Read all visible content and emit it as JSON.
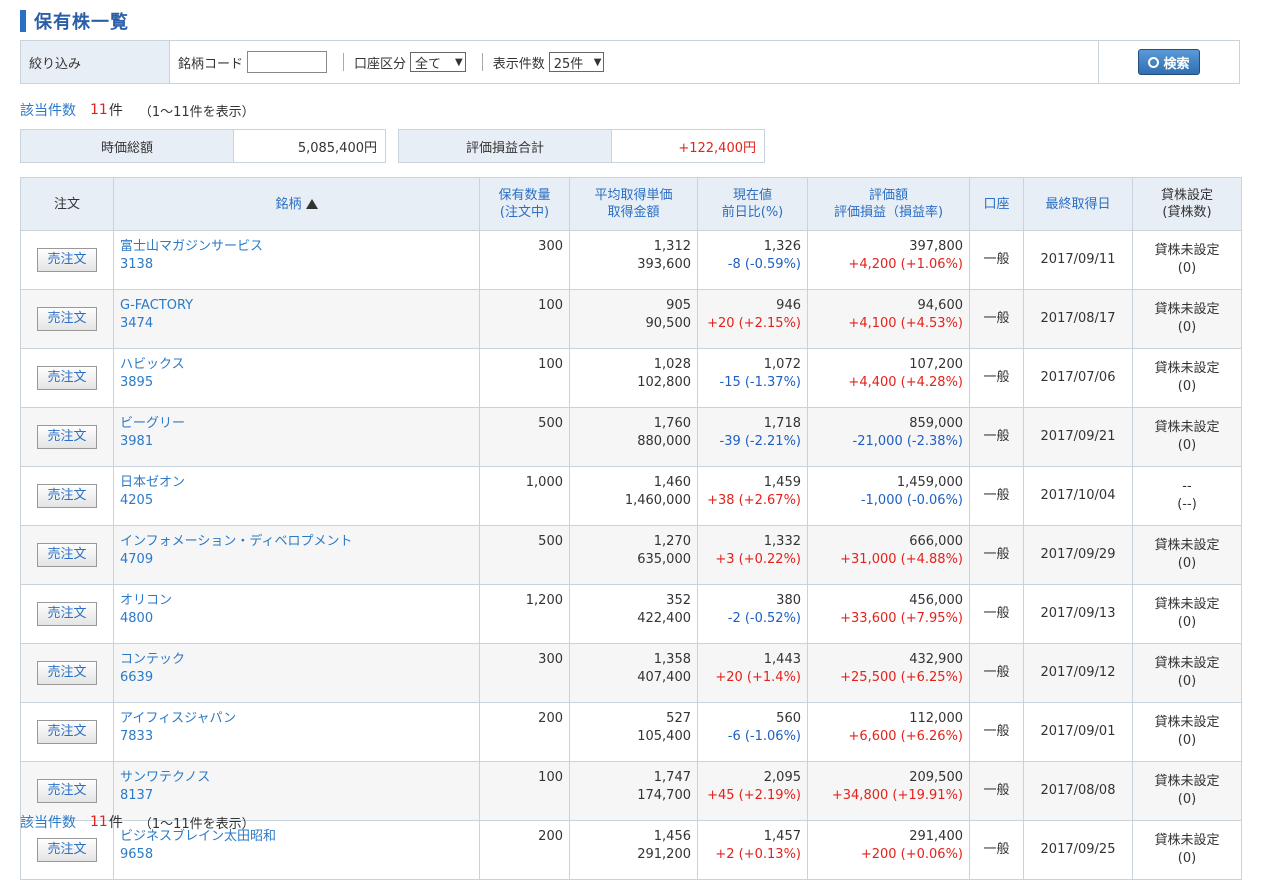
{
  "page": {
    "title": "保有株一覧"
  },
  "filter": {
    "label": "絞り込み",
    "code_label": "銘柄コード",
    "code_value": "",
    "account_label": "口座区分",
    "account_selected": "全て",
    "count_label": "表示件数",
    "count_selected": "25件",
    "search_label": "検索"
  },
  "count_top": {
    "label": "該当件数",
    "num": "11",
    "unit": "件",
    "range": "（1～11件を表示）"
  },
  "count_bottom": {
    "label": "該当件数",
    "num": "11",
    "unit": "件",
    "range": "（1～11件を表示）"
  },
  "summary": {
    "market_value_label": "時価総額",
    "market_value": "5,085,400円",
    "pl_total_label": "評価損益合計",
    "pl_total": "+122,400円"
  },
  "table": {
    "headers": {
      "order": "注文",
      "stock": "銘柄",
      "qty1": "保有数量",
      "qty2": "(注文中)",
      "avg1": "平均取得単価",
      "avg2": "取得金額",
      "price1": "現在値",
      "price2": "前日比(%)",
      "val1": "評価額",
      "val2": "評価損益（損益率)",
      "account": "口座",
      "date": "最終取得日",
      "lend1": "貸株設定",
      "lend2": "(貸株数)"
    },
    "sell_label": "売注文",
    "rows": [
      {
        "name": "富士山マガジンサービス",
        "code": "3138",
        "qty": "300",
        "avg": "1,312",
        "cost": "393,600",
        "price": "1,326",
        "change": "-8 (-0.59%)",
        "change_sign": "neg",
        "value": "397,800",
        "pl": "+4,200 (+1.06%)",
        "pl_sign": "pos",
        "account": "一般",
        "date": "2017/09/11",
        "lend": "貸株未設定",
        "lend_count": "(0)"
      },
      {
        "name": "G-FACTORY",
        "code": "3474",
        "qty": "100",
        "avg": "905",
        "cost": "90,500",
        "price": "946",
        "change": "+20 (+2.15%)",
        "change_sign": "pos",
        "value": "94,600",
        "pl": "+4,100 (+4.53%)",
        "pl_sign": "pos",
        "account": "一般",
        "date": "2017/08/17",
        "lend": "貸株未設定",
        "lend_count": "(0)"
      },
      {
        "name": "ハビックス",
        "code": "3895",
        "qty": "100",
        "avg": "1,028",
        "cost": "102,800",
        "price": "1,072",
        "change": "-15 (-1.37%)",
        "change_sign": "neg",
        "value": "107,200",
        "pl": "+4,400 (+4.28%)",
        "pl_sign": "pos",
        "account": "一般",
        "date": "2017/07/06",
        "lend": "貸株未設定",
        "lend_count": "(0)"
      },
      {
        "name": "ビーグリー",
        "code": "3981",
        "qty": "500",
        "avg": "1,760",
        "cost": "880,000",
        "price": "1,718",
        "change": "-39 (-2.21%)",
        "change_sign": "neg",
        "value": "859,000",
        "pl": "-21,000 (-2.38%)",
        "pl_sign": "neg",
        "account": "一般",
        "date": "2017/09/21",
        "lend": "貸株未設定",
        "lend_count": "(0)"
      },
      {
        "name": "日本ゼオン",
        "code": "4205",
        "qty": "1,000",
        "avg": "1,460",
        "cost": "1,460,000",
        "price": "1,459",
        "change": "+38 (+2.67%)",
        "change_sign": "pos",
        "value": "1,459,000",
        "pl": "-1,000 (-0.06%)",
        "pl_sign": "neg",
        "account": "一般",
        "date": "2017/10/04",
        "lend": "--",
        "lend_count": "(--)"
      },
      {
        "name": "インフォメーション・ディベロプメント",
        "code": "4709",
        "qty": "500",
        "avg": "1,270",
        "cost": "635,000",
        "price": "1,332",
        "change": "+3 (+0.22%)",
        "change_sign": "pos",
        "value": "666,000",
        "pl": "+31,000 (+4.88%)",
        "pl_sign": "pos",
        "account": "一般",
        "date": "2017/09/29",
        "lend": "貸株未設定",
        "lend_count": "(0)"
      },
      {
        "name": "オリコン",
        "code": "4800",
        "qty": "1,200",
        "avg": "352",
        "cost": "422,400",
        "price": "380",
        "change": "-2 (-0.52%)",
        "change_sign": "neg",
        "value": "456,000",
        "pl": "+33,600 (+7.95%)",
        "pl_sign": "pos",
        "account": "一般",
        "date": "2017/09/13",
        "lend": "貸株未設定",
        "lend_count": "(0)"
      },
      {
        "name": "コンテック",
        "code": "6639",
        "qty": "300",
        "avg": "1,358",
        "cost": "407,400",
        "price": "1,443",
        "change": "+20 (+1.4%)",
        "change_sign": "pos",
        "value": "432,900",
        "pl": "+25,500 (+6.25%)",
        "pl_sign": "pos",
        "account": "一般",
        "date": "2017/09/12",
        "lend": "貸株未設定",
        "lend_count": "(0)"
      },
      {
        "name": "アイフィスジャパン",
        "code": "7833",
        "qty": "200",
        "avg": "527",
        "cost": "105,400",
        "price": "560",
        "change": "-6 (-1.06%)",
        "change_sign": "neg",
        "value": "112,000",
        "pl": "+6,600 (+6.26%)",
        "pl_sign": "pos",
        "account": "一般",
        "date": "2017/09/01",
        "lend": "貸株未設定",
        "lend_count": "(0)"
      },
      {
        "name": "サンワテクノス",
        "code": "8137",
        "qty": "100",
        "avg": "1,747",
        "cost": "174,700",
        "price": "2,095",
        "change": "+45 (+2.19%)",
        "change_sign": "pos",
        "value": "209,500",
        "pl": "+34,800 (+19.91%)",
        "pl_sign": "pos",
        "account": "一般",
        "date": "2017/08/08",
        "lend": "貸株未設定",
        "lend_count": "(0)"
      },
      {
        "name": "ビジネスブレイン太田昭和",
        "code": "9658",
        "qty": "200",
        "avg": "1,456",
        "cost": "291,200",
        "price": "1,457",
        "change": "+2 (+0.13%)",
        "change_sign": "pos",
        "value": "291,400",
        "pl": "+200 (+0.06%)",
        "pl_sign": "pos",
        "account": "一般",
        "date": "2017/09/25",
        "lend": "貸株未設定",
        "lend_count": "(0)"
      }
    ]
  },
  "colors": {
    "positive": "#e4221b",
    "negative": "#1d5fc4",
    "link": "#2a7ac8",
    "header_bg": "#e8eef5"
  }
}
